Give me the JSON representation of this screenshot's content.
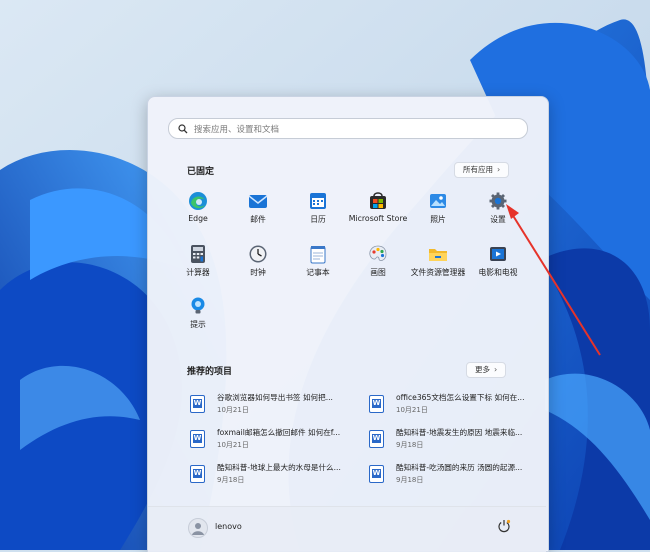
{
  "start_menu": {
    "search_placeholder": "搜索应用、设置和文档",
    "pinned_title": "已固定",
    "all_apps_label": "所有应用",
    "pinned_apps": [
      {
        "label": "Edge",
        "icon": "edge-icon"
      },
      {
        "label": "邮件",
        "icon": "mail-icon"
      },
      {
        "label": "日历",
        "icon": "calendar-icon"
      },
      {
        "label": "Microsoft Store",
        "icon": "store-icon"
      },
      {
        "label": "照片",
        "icon": "photos-icon"
      },
      {
        "label": "设置",
        "icon": "gear-icon"
      },
      {
        "label": "计算器",
        "icon": "calculator-icon"
      },
      {
        "label": "时钟",
        "icon": "clock-icon"
      },
      {
        "label": "记事本",
        "icon": "notepad-icon"
      },
      {
        "label": "画图",
        "icon": "paint-icon"
      },
      {
        "label": "文件资源管理器",
        "icon": "folder-icon"
      },
      {
        "label": "电影和电视",
        "icon": "movies-tv-icon"
      },
      {
        "label": "提示",
        "icon": "tips-icon"
      }
    ],
    "recommended_title": "推荐的项目",
    "more_label": "更多",
    "recommended": [
      {
        "title": "谷歌浏览器如何导出书签 如何把...",
        "date": "10月21日"
      },
      {
        "title": "office365文档怎么设置下标 如何在...",
        "date": "10月21日"
      },
      {
        "title": "foxmail邮箱怎么撤回邮件 如何在f...",
        "date": "10月21日"
      },
      {
        "title": "酷知科普-地震发生的原因 地震来临...",
        "date": "9月18日"
      },
      {
        "title": "酷知科普-地球上最大的水母是什么...",
        "date": "9月18日"
      },
      {
        "title": "酷知科普-吃汤圆的来历 汤圆的起源...",
        "date": "9月18日"
      }
    ],
    "user_name": "lenovo",
    "doc_badge": "W"
  },
  "colors": {
    "accent": "#0067c0",
    "arrow": "#e6332a",
    "wallpaper_bg": "#cfe0ef",
    "bloom": "#1a5fd6"
  }
}
